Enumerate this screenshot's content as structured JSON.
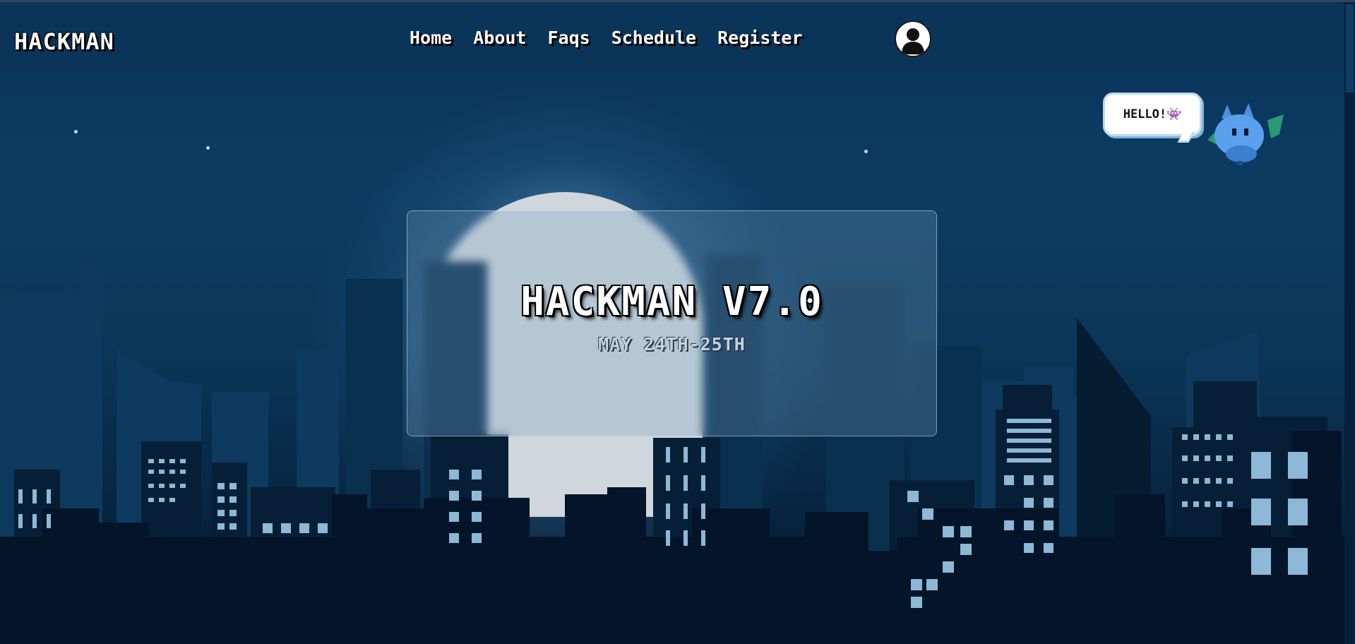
{
  "app": {
    "logo": "HACKMAN"
  },
  "nav": {
    "items": [
      {
        "label": "Home"
      },
      {
        "label": "About"
      },
      {
        "label": "Faqs"
      },
      {
        "label": "Schedule"
      },
      {
        "label": "Register"
      }
    ],
    "profile_icon": "user-icon"
  },
  "hero": {
    "title": "HACKMAN V7.0",
    "date": "MAY 24TH-25TH"
  },
  "mascot": {
    "speech": "HELLO!👾",
    "icon": "bat-cat-mascot-icon"
  },
  "colors": {
    "navbar": "#0a3559",
    "sky_top": "#0a3358",
    "city_dark": "#041628",
    "window_light": "#8db8d8",
    "moon": "#cfd6dc"
  }
}
